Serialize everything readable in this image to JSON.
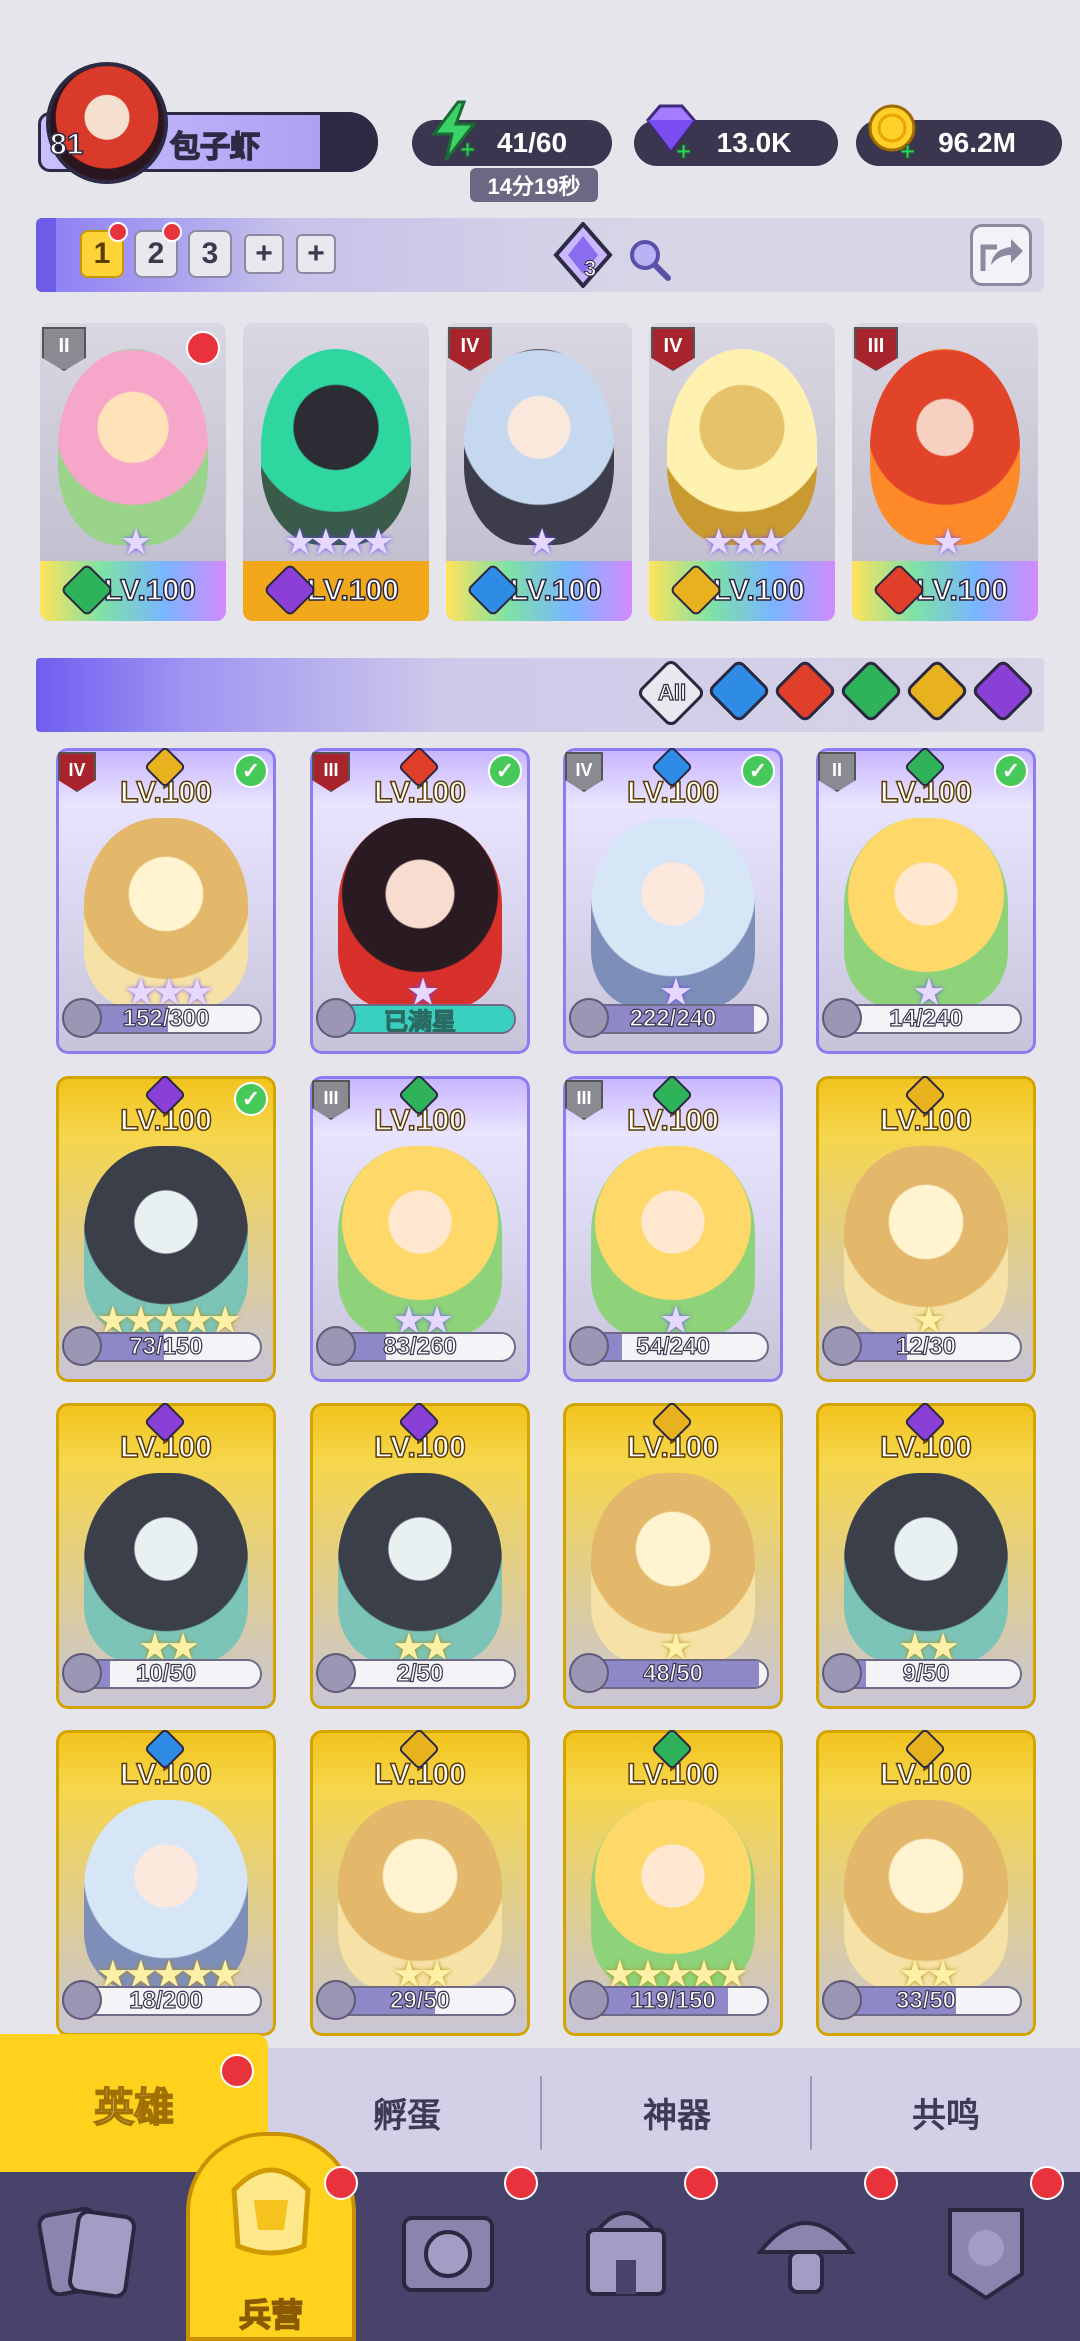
{
  "player": {
    "level": "81",
    "name": "包子虾"
  },
  "resources": {
    "energy": "41/60",
    "energy_timer": "14分19秒",
    "gems": "13.0K",
    "gold": "96.2M"
  },
  "deck": {
    "slots": [
      "1",
      "2",
      "3",
      "+",
      "+"
    ],
    "active": "1",
    "counter": "3"
  },
  "team": [
    {
      "rank": "II",
      "level": "LV.100",
      "element": "wind",
      "stars": "★",
      "alert": true
    },
    {
      "rank": "",
      "level": "LV.100",
      "element": "dark",
      "stars": "★★★★",
      "alert": false
    },
    {
      "rank": "IV",
      "level": "LV.100",
      "element": "water",
      "stars": "★",
      "alert": false
    },
    {
      "rank": "IV",
      "level": "LV.100",
      "element": "light",
      "stars": "★★★",
      "alert": false
    },
    {
      "rank": "III",
      "level": "LV.100",
      "element": "fire",
      "stars": "★",
      "alert": false
    }
  ],
  "filter": {
    "all_label": "All",
    "elements": [
      "water",
      "fire",
      "wind",
      "light",
      "dark"
    ]
  },
  "heroes": [
    {
      "rank": "IV",
      "level": "LV.100",
      "element": "light",
      "checked": true,
      "stars": "★★★",
      "star_style": "purple",
      "progress": "152/300",
      "pct": 0.51
    },
    {
      "rank": "III",
      "level": "LV.100",
      "element": "fire",
      "checked": true,
      "stars": "★",
      "star_style": "purple",
      "progress": "已满星",
      "pct": 1.0
    },
    {
      "rank": "IV",
      "level": "LV.100",
      "element": "water",
      "checked": true,
      "stars": "★",
      "star_style": "purple",
      "progress": "222/240",
      "pct": 0.93
    },
    {
      "rank": "II",
      "level": "LV.100",
      "element": "wind",
      "checked": true,
      "stars": "★",
      "star_style": "purple",
      "progress": "14/240",
      "pct": 0.06
    },
    {
      "rank": "",
      "level": "LV.100",
      "element": "dark",
      "checked": true,
      "stars": "★★★★★",
      "star_style": "gold",
      "progress": "73/150",
      "pct": 0.49
    },
    {
      "rank": "III",
      "level": "LV.100",
      "element": "wind",
      "checked": false,
      "stars": "★★",
      "star_style": "purple",
      "progress": "83/260",
      "pct": 0.32
    },
    {
      "rank": "III",
      "level": "LV.100",
      "element": "wind",
      "checked": false,
      "stars": "★",
      "star_style": "purple",
      "progress": "54/240",
      "pct": 0.23
    },
    {
      "rank": "",
      "level": "LV.100",
      "element": "light",
      "checked": false,
      "stars": "★",
      "star_style": "gold",
      "progress": "12/30",
      "pct": 0.4
    },
    {
      "rank": "",
      "level": "LV.100",
      "element": "dark",
      "checked": false,
      "stars": "★★",
      "star_style": "gold",
      "progress": "10/50",
      "pct": 0.2
    },
    {
      "rank": "",
      "level": "LV.100",
      "element": "dark",
      "checked": false,
      "stars": "★★",
      "star_style": "gold",
      "progress": "2/50",
      "pct": 0.04
    },
    {
      "rank": "",
      "level": "LV.100",
      "element": "light",
      "checked": false,
      "stars": "★",
      "star_style": "gold",
      "progress": "48/50",
      "pct": 0.96
    },
    {
      "rank": "",
      "level": "LV.100",
      "element": "dark",
      "checked": false,
      "stars": "★★",
      "star_style": "gold",
      "progress": "9/50",
      "pct": 0.18
    },
    {
      "rank": "",
      "level": "LV.100",
      "element": "water",
      "checked": false,
      "stars": "★★★★★",
      "star_style": "gold",
      "progress": "18/200",
      "pct": 0.09
    },
    {
      "rank": "",
      "level": "LV.100",
      "element": "light",
      "checked": false,
      "stars": "★★",
      "star_style": "gold",
      "progress": "29/50",
      "pct": 0.58
    },
    {
      "rank": "",
      "level": "LV.100",
      "element": "wind",
      "checked": false,
      "stars": "★★★★★",
      "star_style": "gold",
      "progress": "119/150",
      "pct": 0.79
    },
    {
      "rank": "",
      "level": "LV.100",
      "element": "light",
      "checked": false,
      "stars": "★★",
      "star_style": "gold",
      "progress": "33/50",
      "pct": 0.66
    }
  ],
  "tabs": {
    "heroes": "英雄",
    "hatch": "孵蛋",
    "artifact": "神器",
    "resonance": "共鸣"
  },
  "nav": {
    "barracks": "兵营"
  },
  "colors": {
    "water": "#2e8be6",
    "fire": "#e0402a",
    "wind": "#2fb35a",
    "light": "#e8b21f",
    "dark": "#8a3fd6",
    "accent": "#ffd21e",
    "header_purple": "#7b6cf0"
  }
}
